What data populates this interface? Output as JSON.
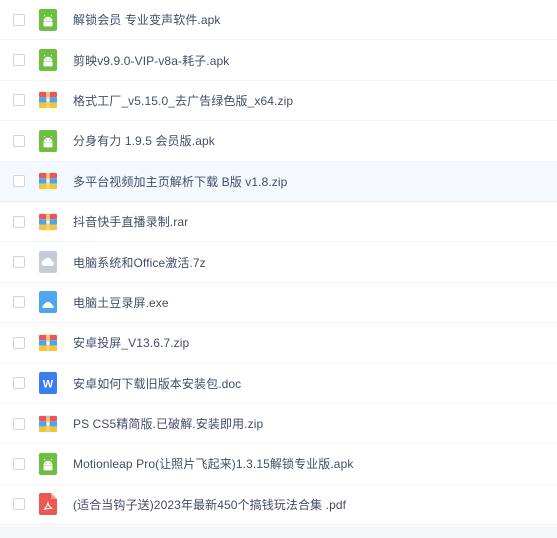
{
  "files": [
    {
      "name": "解锁会员 专业变声软件.apk",
      "type": "apk",
      "icon": "android-apk-icon"
    },
    {
      "name": "剪映v9.9.0-VIP-v8a-耗子.apk",
      "type": "apk",
      "icon": "android-apk-icon"
    },
    {
      "name": "格式工厂_v5.15.0_去广告绿色版_x64.zip",
      "type": "zip",
      "icon": "archive-zip-icon"
    },
    {
      "name": "分身有力 1.9.5 会员版.apk",
      "type": "apk",
      "icon": "android-apk-icon"
    },
    {
      "name": "多平台视频加主页解析下载 B版 v1.8.zip",
      "type": "zip",
      "icon": "archive-zip-icon"
    },
    {
      "name": "抖音快手直播录制.rar",
      "type": "rar",
      "icon": "archive-rar-icon"
    },
    {
      "name": "电脑系统和Office激活.7z",
      "type": "7z",
      "icon": "cloud-file-icon"
    },
    {
      "name": "电脑土豆录屏.exe",
      "type": "exe",
      "icon": "executable-file-icon"
    },
    {
      "name": "安卓投屏_V13.6.7.zip",
      "type": "zip",
      "icon": "archive-zip-icon"
    },
    {
      "name": "安卓如何下载旧版本安装包.doc",
      "type": "doc",
      "icon": "word-document-icon"
    },
    {
      "name": "PS CS5精简版.已破解.安装即用.zip",
      "type": "zip",
      "icon": "archive-zip-icon"
    },
    {
      "name": "Motionleap Pro(让照片飞起来)1.3.15解锁专业版.apk",
      "type": "apk",
      "icon": "android-apk-icon"
    },
    {
      "name": "(适合当钩子送)2023年最新450个搞钱玩法合集 .pdf",
      "type": "pdf",
      "icon": "pdf-document-icon"
    }
  ],
  "colors": {
    "apk": "#6cbf3f",
    "zip_top": "#e8565b",
    "zip_mid": "#4aa6e8",
    "zip_bottom": "#f6c238",
    "cloud": "#c5ccd6",
    "exe": "#4ea7ee",
    "doc": "#3b7ef0",
    "pdf": "#ec5a4f",
    "text": "#424e67",
    "hover_row": "#f4f9ff"
  },
  "hovered_row": 4
}
